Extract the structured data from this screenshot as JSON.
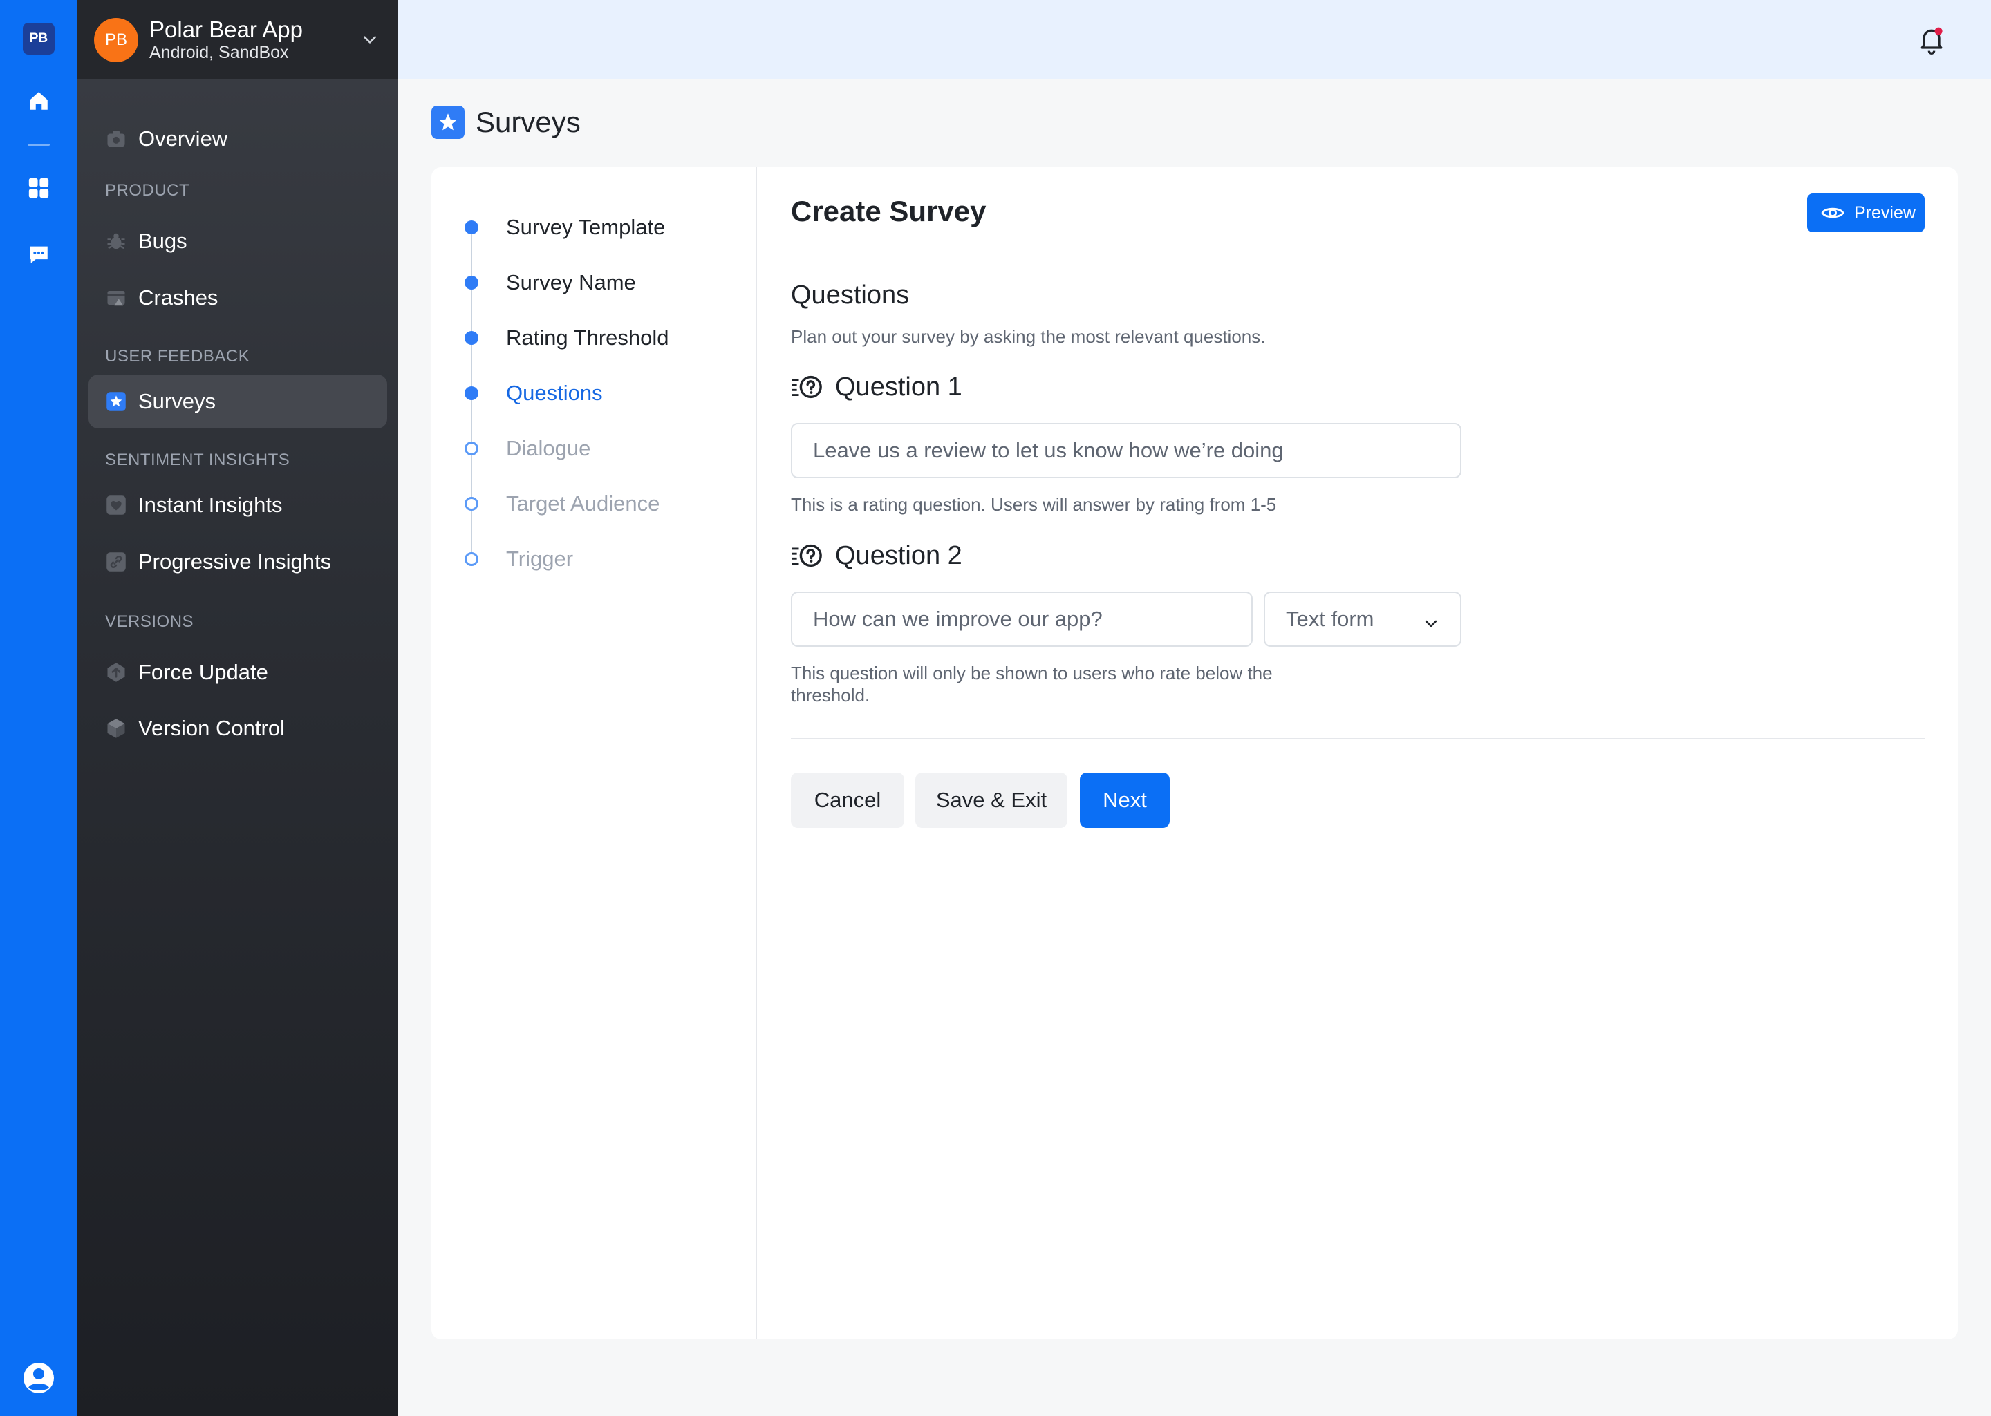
{
  "rail": {
    "logo": "PB",
    "icons": [
      "home-icon",
      "grid-icon",
      "chat-icon",
      "user-icon"
    ]
  },
  "app": {
    "avatar": "PB",
    "name": "Polar Bear App",
    "platform": "Android, SandBox"
  },
  "nav": {
    "overview": "Overview",
    "product_section": "PRODUCT",
    "bugs": "Bugs",
    "crashes": "Crashes",
    "feedback_section": "USER FEEDBACK",
    "surveys": "Surveys",
    "sentiment_section": "SENTIMENT INSIGHTS",
    "instant_insights": "Instant Insights",
    "progressive_insights": "Progressive Insights",
    "versions_section": "VERSIONS",
    "force_update": "Force Update",
    "version_control": "Version Control"
  },
  "page": {
    "title": "Surveys"
  },
  "steps": [
    {
      "label": "Survey Template",
      "state": "done"
    },
    {
      "label": "Survey Name",
      "state": "done"
    },
    {
      "label": "Rating Threshold",
      "state": "done"
    },
    {
      "label": "Questions",
      "state": "current"
    },
    {
      "label": "Dialogue",
      "state": "todo"
    },
    {
      "label": "Target Audience",
      "state": "todo"
    },
    {
      "label": "Trigger",
      "state": "todo"
    }
  ],
  "form": {
    "title": "Create Survey",
    "preview_label": "Preview",
    "section_title": "Questions",
    "section_desc": "Plan out your survey by asking the most relevant questions.",
    "question1": {
      "title": "Question 1",
      "value": "Leave us a review to let us know how we’re doing",
      "hint": "This is a rating question. Users will answer by rating from 1-5"
    },
    "question2": {
      "title": "Question 2",
      "value": "How can we improve our app?",
      "type": "Text form",
      "hint_line1": "This question will only be shown to users who rate below the",
      "hint_line2": "threshold."
    },
    "cancel_label": "Cancel",
    "save_exit_label": "Save & Exit",
    "next_label": "Next"
  },
  "colors": {
    "accent": "#0b6ff5",
    "sidebar": "#2a2d33",
    "avatar": "#f97316",
    "notification_dot": "#e11d48"
  }
}
